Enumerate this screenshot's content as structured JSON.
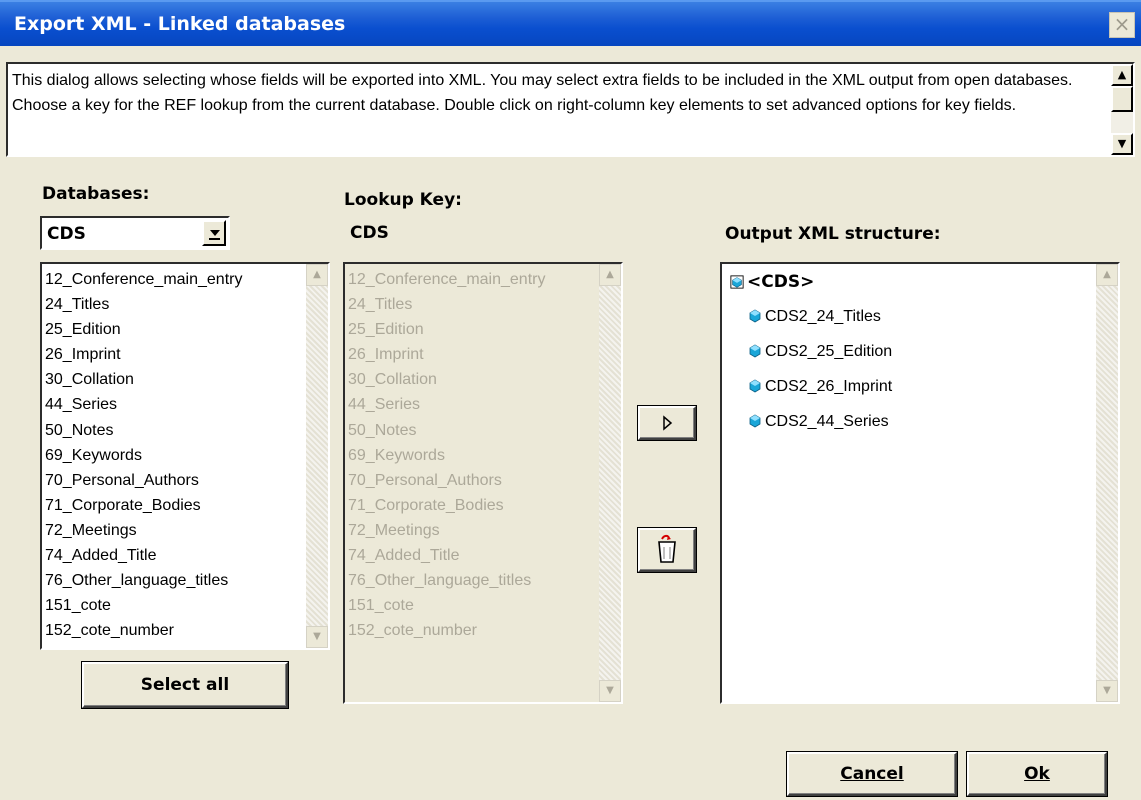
{
  "window": {
    "title": "Export XML - Linked databases",
    "close_symbol": "×"
  },
  "description": "This dialog allows selecting whose fields will be exported into XML. You may select extra fields to be included in the XML output from open databases. Choose a key for the REF lookup from the current database. Double click on right-column key elements to set advanced options for key fields.",
  "databases": {
    "label": "Databases:",
    "selected": "CDS",
    "fields": [
      "12_Conference_main_entry",
      "24_Titles",
      "25_Edition",
      "26_Imprint",
      "30_Collation",
      "44_Series",
      "50_Notes",
      "69_Keywords",
      "70_Personal_Authors",
      "71_Corporate_Bodies",
      "72_Meetings",
      "74_Added_Title",
      "76_Other_language_titles",
      "151_cote",
      "152_cote_number"
    ],
    "select_all_label": "Select all"
  },
  "lookup_key": {
    "label": "Lookup Key:",
    "database": "CDS",
    "fields": [
      "12_Conference_main_entry",
      "24_Titles",
      "25_Edition",
      "26_Imprint",
      "30_Collation",
      "44_Series",
      "50_Notes",
      "69_Keywords",
      "70_Personal_Authors",
      "71_Corporate_Bodies",
      "72_Meetings",
      "74_Added_Title",
      "76_Other_language_titles",
      "151_cote",
      "152_cote_number"
    ]
  },
  "output": {
    "label": "Output XML structure:",
    "root": "<CDS>",
    "children": [
      "CDS2_24_Titles",
      "CDS2_25_Edition",
      "CDS2_26_Imprint",
      "CDS2_44_Series"
    ]
  },
  "buttons": {
    "cancel": "Cancel",
    "ok": "Ok"
  },
  "colors": {
    "title_bar": "#0a4fcf",
    "dialog_bg": "#ece9d8",
    "disabled_text": "#aca899",
    "gem": "#1aa6d8"
  },
  "icons": {
    "add": "play-right-icon",
    "remove": "trash-can-icon",
    "node": "gem-icon",
    "root": "database-node-icon"
  }
}
